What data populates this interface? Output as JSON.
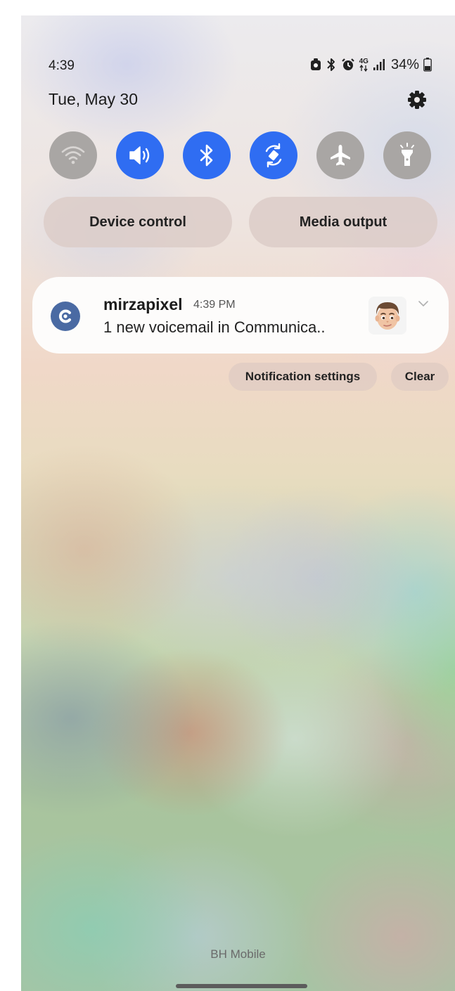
{
  "status_bar": {
    "time": "4:39",
    "network": "4G",
    "battery": "34%"
  },
  "panel": {
    "date": "Tue, May 30"
  },
  "quick_settings": [
    {
      "name": "wifi-icon",
      "state": "off"
    },
    {
      "name": "sound-icon",
      "state": "on"
    },
    {
      "name": "bluetooth-icon",
      "state": "on"
    },
    {
      "name": "auto-rotate-icon",
      "state": "on"
    },
    {
      "name": "airplane-mode-icon",
      "state": "off"
    },
    {
      "name": "flashlight-icon",
      "state": "off"
    }
  ],
  "buttons": {
    "device_control": "Device control",
    "media_output": "Media output"
  },
  "notification": {
    "app_name": "mirzapixel",
    "time": "4:39 PM",
    "body": "1 new voicemail in Communica.."
  },
  "actions": {
    "settings": "Notification settings",
    "clear": "Clear"
  },
  "carrier": "BH Mobile",
  "colors": {
    "accent_on": "#2f6df2",
    "toggle_off": "#a9a6a4",
    "app_icon": "#4a6aa3"
  }
}
